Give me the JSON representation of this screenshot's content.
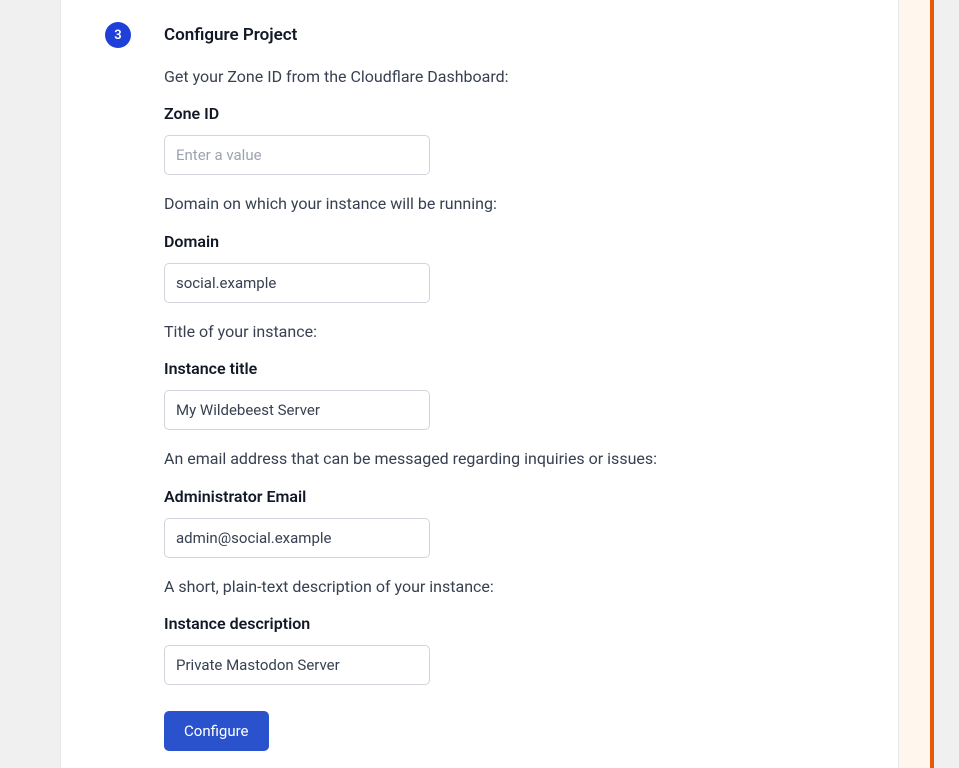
{
  "step": {
    "number": "3",
    "title": "Configure Project"
  },
  "fields": {
    "zone_id": {
      "description": "Get your Zone ID from the Cloudflare Dashboard:",
      "label": "Zone ID",
      "placeholder": "Enter a value",
      "value": ""
    },
    "domain": {
      "description": "Domain on which your instance will be running:",
      "label": "Domain",
      "value": "social.example"
    },
    "instance_title": {
      "description": "Title of your instance:",
      "label": "Instance title",
      "value": "My Wildebeest Server"
    },
    "admin_email": {
      "description": "An email address that can be messaged regarding inquiries or issues:",
      "label": "Administrator Email",
      "value": "admin@social.example"
    },
    "instance_description": {
      "description": "A short, plain-text description of your instance:",
      "label": "Instance description",
      "value": "Private Mastodon Server"
    }
  },
  "buttons": {
    "configure": "Configure"
  }
}
